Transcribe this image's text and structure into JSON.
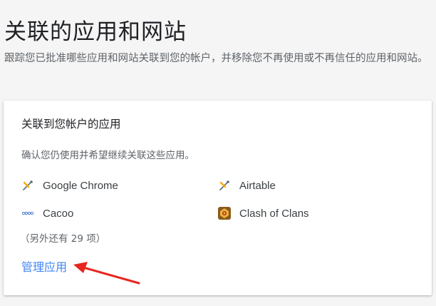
{
  "page": {
    "title": "关联的应用和网站",
    "description": "跟踪您已批准哪些应用和网站关联到您的帐户，并移除您不再使用或不再信任的应用和网站。"
  },
  "card": {
    "title": "关联到您帐户的应用",
    "description": "确认您仍使用并希望继续关联这些应用。",
    "apps": [
      {
        "name": "Google Chrome",
        "icon": "chrome-key-icon"
      },
      {
        "name": "Airtable",
        "icon": "airtable-key-icon"
      },
      {
        "name": "Cacoo",
        "icon": "cacoo-logo-icon"
      },
      {
        "name": "Clash of Clans",
        "icon": "clash-of-clans-icon"
      }
    ],
    "more_count_text": "（另外还有 29 项）",
    "manage_link_label": "管理应用"
  },
  "colors": {
    "link": "#4285f4",
    "annotation_arrow": "#e8261f",
    "background": "#f5f5f5",
    "card": "#ffffff"
  }
}
